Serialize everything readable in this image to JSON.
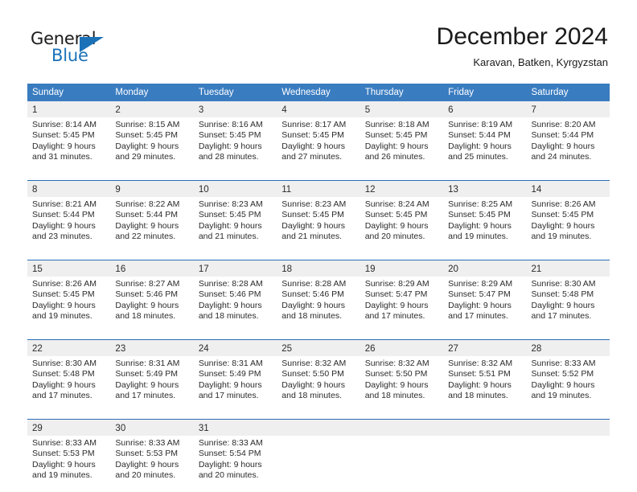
{
  "brand": {
    "name_part1": "General",
    "name_part2": "Blue",
    "accent_color": "#1a71b8"
  },
  "header": {
    "title": "December 2024",
    "subtitle": "Karavan, Batken, Kyrgyzstan"
  },
  "theme": {
    "header_row_color": "#3a7cc0",
    "day_number_band_color": "#efefef",
    "week_separator_color": "#2a6db5"
  },
  "calendar": {
    "weekday_headers": [
      "Sunday",
      "Monday",
      "Tuesday",
      "Wednesday",
      "Thursday",
      "Friday",
      "Saturday"
    ],
    "weeks": [
      {
        "days": [
          {
            "num": "1",
            "sunrise": "Sunrise: 8:14 AM",
            "sunset": "Sunset: 5:45 PM",
            "daylight1": "Daylight: 9 hours",
            "daylight2": "and 31 minutes."
          },
          {
            "num": "2",
            "sunrise": "Sunrise: 8:15 AM",
            "sunset": "Sunset: 5:45 PM",
            "daylight1": "Daylight: 9 hours",
            "daylight2": "and 29 minutes."
          },
          {
            "num": "3",
            "sunrise": "Sunrise: 8:16 AM",
            "sunset": "Sunset: 5:45 PM",
            "daylight1": "Daylight: 9 hours",
            "daylight2": "and 28 minutes."
          },
          {
            "num": "4",
            "sunrise": "Sunrise: 8:17 AM",
            "sunset": "Sunset: 5:45 PM",
            "daylight1": "Daylight: 9 hours",
            "daylight2": "and 27 minutes."
          },
          {
            "num": "5",
            "sunrise": "Sunrise: 8:18 AM",
            "sunset": "Sunset: 5:45 PM",
            "daylight1": "Daylight: 9 hours",
            "daylight2": "and 26 minutes."
          },
          {
            "num": "6",
            "sunrise": "Sunrise: 8:19 AM",
            "sunset": "Sunset: 5:44 PM",
            "daylight1": "Daylight: 9 hours",
            "daylight2": "and 25 minutes."
          },
          {
            "num": "7",
            "sunrise": "Sunrise: 8:20 AM",
            "sunset": "Sunset: 5:44 PM",
            "daylight1": "Daylight: 9 hours",
            "daylight2": "and 24 minutes."
          }
        ]
      },
      {
        "days": [
          {
            "num": "8",
            "sunrise": "Sunrise: 8:21 AM",
            "sunset": "Sunset: 5:44 PM",
            "daylight1": "Daylight: 9 hours",
            "daylight2": "and 23 minutes."
          },
          {
            "num": "9",
            "sunrise": "Sunrise: 8:22 AM",
            "sunset": "Sunset: 5:44 PM",
            "daylight1": "Daylight: 9 hours",
            "daylight2": "and 22 minutes."
          },
          {
            "num": "10",
            "sunrise": "Sunrise: 8:23 AM",
            "sunset": "Sunset: 5:45 PM",
            "daylight1": "Daylight: 9 hours",
            "daylight2": "and 21 minutes."
          },
          {
            "num": "11",
            "sunrise": "Sunrise: 8:23 AM",
            "sunset": "Sunset: 5:45 PM",
            "daylight1": "Daylight: 9 hours",
            "daylight2": "and 21 minutes."
          },
          {
            "num": "12",
            "sunrise": "Sunrise: 8:24 AM",
            "sunset": "Sunset: 5:45 PM",
            "daylight1": "Daylight: 9 hours",
            "daylight2": "and 20 minutes."
          },
          {
            "num": "13",
            "sunrise": "Sunrise: 8:25 AM",
            "sunset": "Sunset: 5:45 PM",
            "daylight1": "Daylight: 9 hours",
            "daylight2": "and 19 minutes."
          },
          {
            "num": "14",
            "sunrise": "Sunrise: 8:26 AM",
            "sunset": "Sunset: 5:45 PM",
            "daylight1": "Daylight: 9 hours",
            "daylight2": "and 19 minutes."
          }
        ]
      },
      {
        "days": [
          {
            "num": "15",
            "sunrise": "Sunrise: 8:26 AM",
            "sunset": "Sunset: 5:45 PM",
            "daylight1": "Daylight: 9 hours",
            "daylight2": "and 19 minutes."
          },
          {
            "num": "16",
            "sunrise": "Sunrise: 8:27 AM",
            "sunset": "Sunset: 5:46 PM",
            "daylight1": "Daylight: 9 hours",
            "daylight2": "and 18 minutes."
          },
          {
            "num": "17",
            "sunrise": "Sunrise: 8:28 AM",
            "sunset": "Sunset: 5:46 PM",
            "daylight1": "Daylight: 9 hours",
            "daylight2": "and 18 minutes."
          },
          {
            "num": "18",
            "sunrise": "Sunrise: 8:28 AM",
            "sunset": "Sunset: 5:46 PM",
            "daylight1": "Daylight: 9 hours",
            "daylight2": "and 18 minutes."
          },
          {
            "num": "19",
            "sunrise": "Sunrise: 8:29 AM",
            "sunset": "Sunset: 5:47 PM",
            "daylight1": "Daylight: 9 hours",
            "daylight2": "and 17 minutes."
          },
          {
            "num": "20",
            "sunrise": "Sunrise: 8:29 AM",
            "sunset": "Sunset: 5:47 PM",
            "daylight1": "Daylight: 9 hours",
            "daylight2": "and 17 minutes."
          },
          {
            "num": "21",
            "sunrise": "Sunrise: 8:30 AM",
            "sunset": "Sunset: 5:48 PM",
            "daylight1": "Daylight: 9 hours",
            "daylight2": "and 17 minutes."
          }
        ]
      },
      {
        "days": [
          {
            "num": "22",
            "sunrise": "Sunrise: 8:30 AM",
            "sunset": "Sunset: 5:48 PM",
            "daylight1": "Daylight: 9 hours",
            "daylight2": "and 17 minutes."
          },
          {
            "num": "23",
            "sunrise": "Sunrise: 8:31 AM",
            "sunset": "Sunset: 5:49 PM",
            "daylight1": "Daylight: 9 hours",
            "daylight2": "and 17 minutes."
          },
          {
            "num": "24",
            "sunrise": "Sunrise: 8:31 AM",
            "sunset": "Sunset: 5:49 PM",
            "daylight1": "Daylight: 9 hours",
            "daylight2": "and 17 minutes."
          },
          {
            "num": "25",
            "sunrise": "Sunrise: 8:32 AM",
            "sunset": "Sunset: 5:50 PM",
            "daylight1": "Daylight: 9 hours",
            "daylight2": "and 18 minutes."
          },
          {
            "num": "26",
            "sunrise": "Sunrise: 8:32 AM",
            "sunset": "Sunset: 5:50 PM",
            "daylight1": "Daylight: 9 hours",
            "daylight2": "and 18 minutes."
          },
          {
            "num": "27",
            "sunrise": "Sunrise: 8:32 AM",
            "sunset": "Sunset: 5:51 PM",
            "daylight1": "Daylight: 9 hours",
            "daylight2": "and 18 minutes."
          },
          {
            "num": "28",
            "sunrise": "Sunrise: 8:33 AM",
            "sunset": "Sunset: 5:52 PM",
            "daylight1": "Daylight: 9 hours",
            "daylight2": "and 19 minutes."
          }
        ]
      },
      {
        "days": [
          {
            "num": "29",
            "sunrise": "Sunrise: 8:33 AM",
            "sunset": "Sunset: 5:53 PM",
            "daylight1": "Daylight: 9 hours",
            "daylight2": "and 19 minutes."
          },
          {
            "num": "30",
            "sunrise": "Sunrise: 8:33 AM",
            "sunset": "Sunset: 5:53 PM",
            "daylight1": "Daylight: 9 hours",
            "daylight2": "and 20 minutes."
          },
          {
            "num": "31",
            "sunrise": "Sunrise: 8:33 AM",
            "sunset": "Sunset: 5:54 PM",
            "daylight1": "Daylight: 9 hours",
            "daylight2": "and 20 minutes."
          },
          {
            "num": "",
            "sunrise": "",
            "sunset": "",
            "daylight1": "",
            "daylight2": ""
          },
          {
            "num": "",
            "sunrise": "",
            "sunset": "",
            "daylight1": "",
            "daylight2": ""
          },
          {
            "num": "",
            "sunrise": "",
            "sunset": "",
            "daylight1": "",
            "daylight2": ""
          },
          {
            "num": "",
            "sunrise": "",
            "sunset": "",
            "daylight1": "",
            "daylight2": ""
          }
        ]
      }
    ]
  }
}
